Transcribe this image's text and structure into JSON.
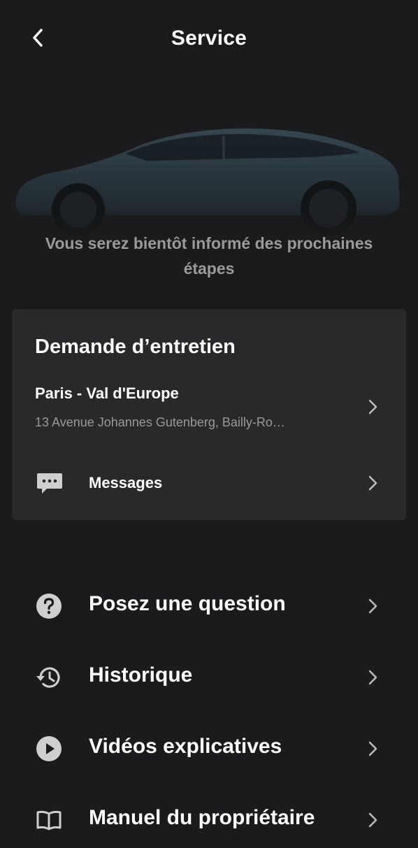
{
  "header": {
    "title": "Service"
  },
  "hero": {
    "message_line1": "Vous serez bientôt informé des prochaines",
    "message_line2": "étapes"
  },
  "service_request": {
    "title": "Demande d’entretien",
    "location_name": "Paris - Val d'Europe",
    "location_address": "13 Avenue Johannes Gutenberg, Bailly-Ro…",
    "messages_label": "Messages"
  },
  "menu": [
    {
      "label": "Posez une question",
      "icon": "question-icon"
    },
    {
      "label": "Historique",
      "icon": "history-icon"
    },
    {
      "label": "Vidéos explicatives",
      "icon": "play-icon"
    },
    {
      "label": "Manuel du propriétaire",
      "icon": "book-icon"
    }
  ],
  "colors": {
    "background": "#1b1b1d",
    "card": "#29292b",
    "text": "#ffffff",
    "muted_text": "#9a9a9c",
    "icon": "#cfcfd1"
  }
}
